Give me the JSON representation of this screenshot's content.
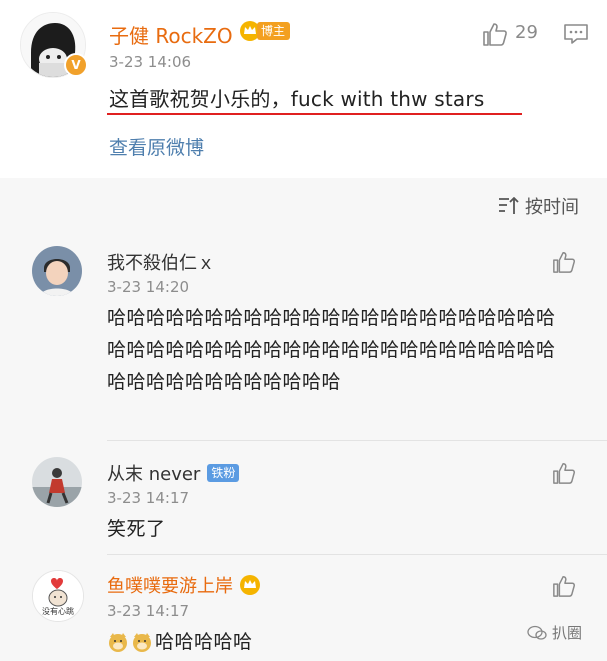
{
  "post": {
    "author": "子健 RockZO",
    "author_tag": "博主",
    "time": "3-23 14:06",
    "like_count": "29",
    "text": "这首歌祝贺小乐的，fuck with thw stars",
    "view_original": "查看原微博"
  },
  "sort": {
    "label": "按时间"
  },
  "comments": [
    {
      "name": "我不殺伯仁ｘ",
      "time": "3-23 14:20",
      "text": "哈哈哈哈哈哈哈哈哈哈哈哈哈哈哈哈哈哈哈哈哈哈哈哈哈哈哈哈哈哈哈哈哈哈哈哈哈哈哈哈哈哈哈哈哈哈哈哈哈哈哈哈哈哈哈哈哈哈"
    },
    {
      "name": "从末 never",
      "tag": "铁粉",
      "time": "3-23 14:17",
      "text": "笑死了"
    },
    {
      "name": "鱼噗噗要游上岸",
      "time": "3-23 14:17",
      "text": "哈哈哈哈哈",
      "avatar_caption": "没有心跳"
    }
  ],
  "watermark": {
    "label": "扒圈"
  },
  "colors": {
    "orange_name": "#e86b0f",
    "link_blue": "#4f7fae",
    "underline_red": "#e02020",
    "fan_tag": "#5b9be2"
  }
}
